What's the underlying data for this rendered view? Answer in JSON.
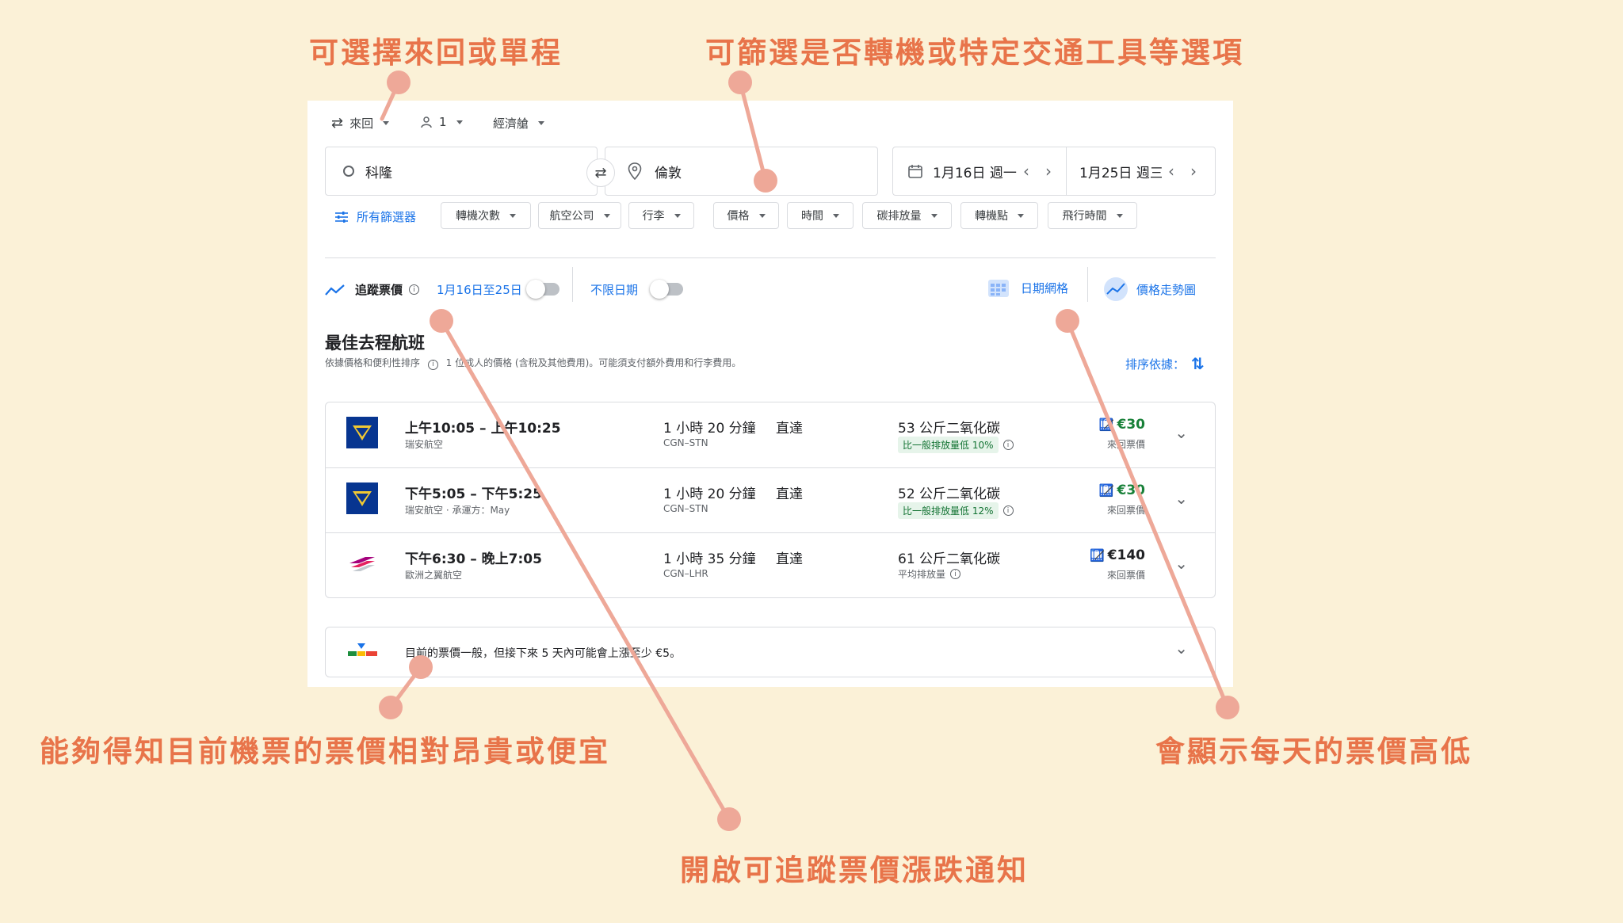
{
  "annotations": {
    "trip_type": "可選擇來回或單程",
    "filters": "可篩選是否轉機或特定交通工具等選項",
    "price_insight": "能夠得知目前機票的票價相對昂貴或便宜",
    "date_grid": "會顯示每天的票價高低",
    "track_prices": "開啟可追蹤票價漲跌通知"
  },
  "search": {
    "trip_type": "來回",
    "passengers": "1",
    "cabin": "經濟艙",
    "origin": "科隆",
    "destination": "倫敦",
    "depart_date": "1月16日 週一",
    "return_date": "1月25日 週三"
  },
  "filters": {
    "all": "所有篩選器",
    "chips": [
      "轉機次數",
      "航空公司",
      "行李",
      "價格",
      "時間",
      "碳排放量",
      "轉機點",
      "飛行時間"
    ]
  },
  "tracking": {
    "label": "追蹤票價",
    "date_range": "1月16日至25日",
    "any_dates": "不限日期",
    "date_grid": "日期網格",
    "price_graph": "價格走勢圖"
  },
  "results": {
    "heading": "最佳去程航班",
    "sort_note": "依據價格和便利性排序",
    "price_note": "1 位成人的價格 (含稅及其他費用)。可能須支付額外費用和行李費用。",
    "sort_label": "排序依據：",
    "flights": [
      {
        "time": "上午10:05 – 上午10:25",
        "airline": "瑞安航空",
        "duration": "1 小時 20 分鐘",
        "route": "CGN–STN",
        "stops": "直達",
        "co2": "53 公斤二氧化碳",
        "co2_note": "比一般排放量低 10%",
        "price": "€30",
        "price_note": "來回票價",
        "logo": "ryanair-logo",
        "price_color": "#188038"
      },
      {
        "time": "下午5:05 – 下午5:25",
        "airline": "瑞安航空 · 承運方：May",
        "duration": "1 小時 20 分鐘",
        "route": "CGN–STN",
        "stops": "直達",
        "co2": "52 公斤二氧化碳",
        "co2_note": "比一般排放量低 12%",
        "price": "€30",
        "price_note": "來回票價",
        "logo": "ryanair-logo",
        "price_color": "#188038"
      },
      {
        "time": "下午6:30 – 晚上7:05",
        "airline": "歐洲之翼航空",
        "duration": "1 小時 35 分鐘",
        "route": "CGN–LHR",
        "stops": "直達",
        "co2": "61 公斤二氧化碳",
        "co2_note": "平均排放量",
        "price": "€140",
        "price_note": "來回票價",
        "logo": "eurowings-logo",
        "price_color": "#202124"
      }
    ],
    "insight": "目前的票價一般，但接下來 5 天內可能會上漲至少 €5。"
  },
  "colors": {
    "background": "#fbf1d7",
    "annotation": "#e8744a",
    "leader": "#eea898",
    "accent": "#1a73e8",
    "green": "#188038"
  }
}
